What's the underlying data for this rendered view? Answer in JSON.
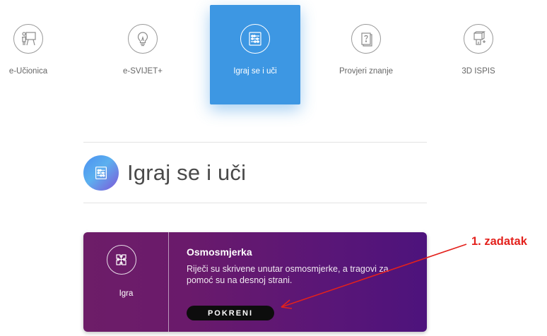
{
  "nav": {
    "items": [
      {
        "label": "e-Učionica",
        "icon": "teacher-board-icon",
        "active": false
      },
      {
        "label": "e-SVIJET+",
        "icon": "lightbulb-icon",
        "active": false
      },
      {
        "label": "Igraj se i uči",
        "icon": "abacus-icon",
        "active": true
      },
      {
        "label": "Provjeri znanje",
        "icon": "question-book-icon",
        "active": false
      },
      {
        "label": "3D ISPIS",
        "icon": "cube-print-icon",
        "active": false
      }
    ]
  },
  "section": {
    "title": "Igraj se i uči",
    "icon": "abacus-icon"
  },
  "card": {
    "type_label": "Igra",
    "icon": "puzzle-icon",
    "title": "Osmosmjerka",
    "description": "Riječi su skrivene unutar osmosmjerke, a tragovi za pomoć su na desnoj strani.",
    "button_label": "POKRENI"
  },
  "annotation": {
    "text": "1. zadatak",
    "color": "#e3211c"
  },
  "colors": {
    "active_tab": "#3d97e3",
    "card_gradient_start": "#6d1d68",
    "card_gradient_end": "#4d137c"
  }
}
